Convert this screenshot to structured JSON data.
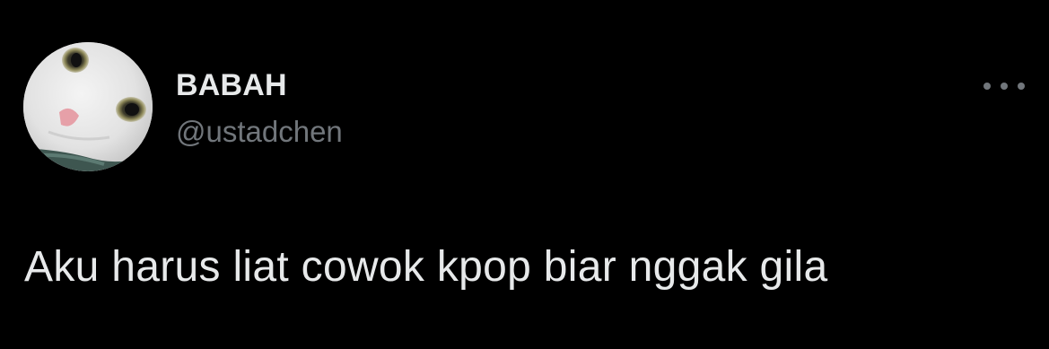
{
  "tweet": {
    "author": {
      "display_name": "BABAH",
      "handle": "@ustadchen",
      "avatar_icon": "cat-avatar"
    },
    "more_icon": "more-horizontal-icon",
    "text": "Aku harus liat cowok kpop biar nggak gila"
  },
  "colors": {
    "background": "#000000",
    "primary_text": "#e7e9ea",
    "secondary_text": "#71767b"
  }
}
